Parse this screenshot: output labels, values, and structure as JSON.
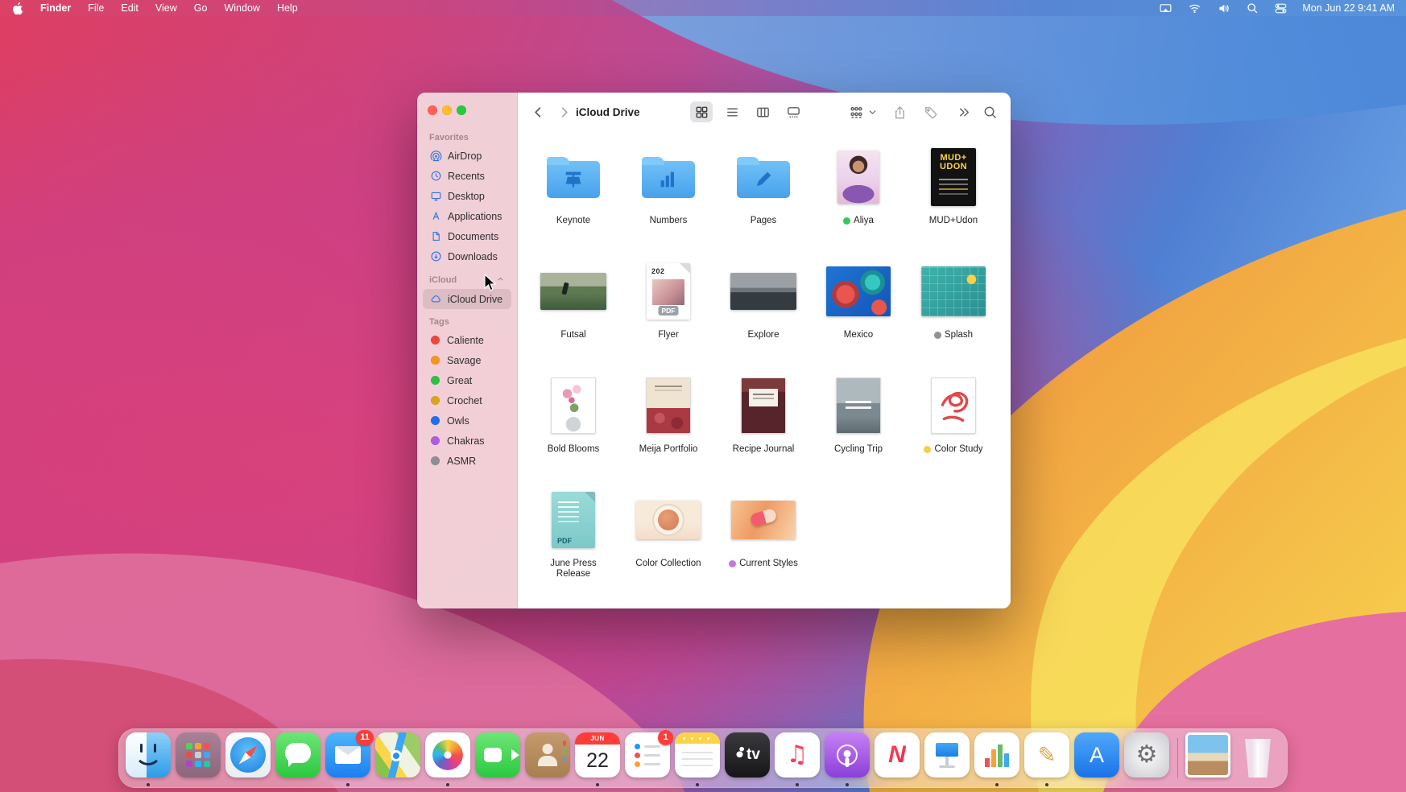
{
  "menu_bar": {
    "app_name": "Finder",
    "items": [
      "File",
      "Edit",
      "View",
      "Go",
      "Window",
      "Help"
    ],
    "status_icons": [
      "screen-mirroring-icon",
      "wifi-icon",
      "volume-icon",
      "spotlight-icon",
      "control-center-icon"
    ],
    "clock": "Mon Jun 22  9:41 AM"
  },
  "window": {
    "title": "iCloud Drive",
    "toolbar": {
      "nav": [
        "back-chevron-icon",
        "forward-chevron-icon"
      ],
      "view_modes": [
        {
          "icon": "grid-view-icon",
          "selected": true
        },
        {
          "icon": "list-view-icon",
          "selected": false
        },
        {
          "icon": "columns-view-icon",
          "selected": false
        },
        {
          "icon": "gallery-view-icon",
          "selected": false
        }
      ],
      "actions": [
        "group-by-icon",
        "chevron-down-icon",
        "share-icon",
        "tag-icon",
        "more-icon",
        "search-icon"
      ]
    },
    "sidebar": {
      "sections": [
        {
          "title": "Favorites",
          "items": [
            {
              "label": "AirDrop",
              "icon": "airdrop-icon"
            },
            {
              "label": "Recents",
              "icon": "recents-icon"
            },
            {
              "label": "Desktop",
              "icon": "desktop-icon"
            },
            {
              "label": "Applications",
              "icon": "applications-icon"
            },
            {
              "label": "Documents",
              "icon": "documents-icon"
            },
            {
              "label": "Downloads",
              "icon": "downloads-icon"
            }
          ]
        },
        {
          "title": "iCloud",
          "collapsible": true,
          "items": [
            {
              "label": "iCloud Drive",
              "icon": "cloud-icon",
              "selected": true
            }
          ]
        },
        {
          "title": "Tags",
          "items": [
            {
              "label": "Caliente",
              "dot_color": "#f0443c"
            },
            {
              "label": "Savage",
              "dot_color": "#f7941d"
            },
            {
              "label": "Great",
              "dot_color": "#2fc043"
            },
            {
              "label": "Crochet",
              "dot_color": "#d9a420"
            },
            {
              "label": "Owls",
              "dot_color": "#1f6ff2"
            },
            {
              "label": "Chakras",
              "dot_color": "#b05be0"
            },
            {
              "label": "ASMR",
              "dot_color": "#8e8e93"
            }
          ]
        }
      ]
    },
    "files": [
      {
        "name": "Keynote",
        "kind": "folder",
        "emblem": "keynote"
      },
      {
        "name": "Numbers",
        "kind": "folder",
        "emblem": "numbers"
      },
      {
        "name": "Pages",
        "kind": "folder",
        "emblem": "pages"
      },
      {
        "name": "Aliya",
        "kind": "image",
        "thumb": "aliya",
        "tag_color": "#34c759"
      },
      {
        "name": "MUD+Udon",
        "kind": "image",
        "thumb": "mud",
        "texts": {
          "line1": "MUD+",
          "line2": "UDON"
        }
      },
      {
        "name": "Futsal",
        "kind": "image",
        "thumb": "futsal"
      },
      {
        "name": "Flyer",
        "kind": "pdf",
        "thumb": "flyer",
        "texts": {
          "top": "202",
          "badge": "PDF"
        }
      },
      {
        "name": "Explore",
        "kind": "image",
        "thumb": "explore"
      },
      {
        "name": "Mexico",
        "kind": "image",
        "thumb": "mexico"
      },
      {
        "name": "Splash",
        "kind": "image",
        "thumb": "splash",
        "tag_color": "#909095"
      },
      {
        "name": "Bold Blooms",
        "kind": "document",
        "thumb": "blooms"
      },
      {
        "name": "Meija Portfolio",
        "kind": "document",
        "thumb": "meija"
      },
      {
        "name": "Recipe Journal",
        "kind": "document",
        "thumb": "recipe"
      },
      {
        "name": "Cycling Trip",
        "kind": "document",
        "thumb": "cycling"
      },
      {
        "name": "Color Study",
        "kind": "document",
        "thumb": "study",
        "tag_color": "#f7ce46"
      },
      {
        "name": "June Press Release",
        "kind": "pdf",
        "thumb": "june",
        "texts": {
          "badge": "PDF"
        }
      },
      {
        "name": "Color Collection",
        "kind": "image",
        "thumb": "cupcol"
      },
      {
        "name": "Current Styles",
        "kind": "image",
        "thumb": "styles",
        "tag_color": "#c577e0"
      }
    ]
  },
  "dock": {
    "items": [
      {
        "name": "Finder",
        "running": true
      },
      {
        "name": "Launchpad",
        "running": false
      },
      {
        "name": "Safari",
        "running": false
      },
      {
        "name": "Messages",
        "running": false
      },
      {
        "name": "Mail",
        "running": true,
        "badge": "11"
      },
      {
        "name": "Maps",
        "running": false
      },
      {
        "name": "Photos",
        "running": true
      },
      {
        "name": "FaceTime",
        "running": false
      },
      {
        "name": "Contacts",
        "running": false
      },
      {
        "name": "Calendar",
        "running": true,
        "month": "JUN",
        "day": "22"
      },
      {
        "name": "Reminders",
        "running": false,
        "badge": "1"
      },
      {
        "name": "Notes",
        "running": true
      },
      {
        "name": "Apple TV",
        "running": false,
        "glyph": "tv"
      },
      {
        "name": "Music",
        "running": true
      },
      {
        "name": "Podcasts",
        "running": true
      },
      {
        "name": "News",
        "running": false,
        "glyph": "N"
      },
      {
        "name": "Keynote",
        "running": false
      },
      {
        "name": "Numbers",
        "running": true
      },
      {
        "name": "Pages",
        "running": true
      },
      {
        "name": "App Store",
        "running": false,
        "glyph": "A"
      },
      {
        "name": "System Preferences",
        "running": false
      },
      {
        "name": "separator",
        "type": "separator"
      },
      {
        "name": "Downloads Stack",
        "running": false
      },
      {
        "name": "Trash",
        "running": false
      }
    ]
  }
}
